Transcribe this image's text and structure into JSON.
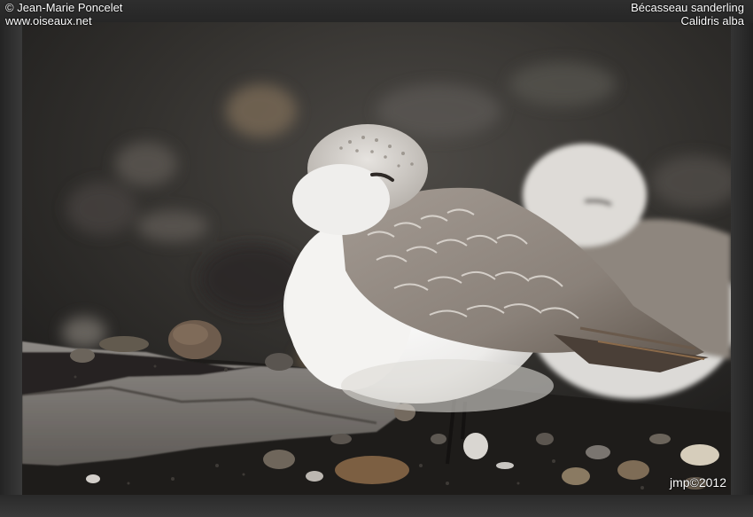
{
  "credit": {
    "author": "© Jean-Marie Poncelet",
    "site": "www.oiseaux.net"
  },
  "species": {
    "common_name": "Bécasseau sanderling",
    "scientific_name": "Calidris alba"
  },
  "watermark": "jmp©2012",
  "colors": {
    "frame": "#2b2b2b",
    "background": "#2f2d2b",
    "plumage_white": "#f1f0ee",
    "plumage_grey": "#8c847c",
    "ground": "#1e1c1a"
  }
}
